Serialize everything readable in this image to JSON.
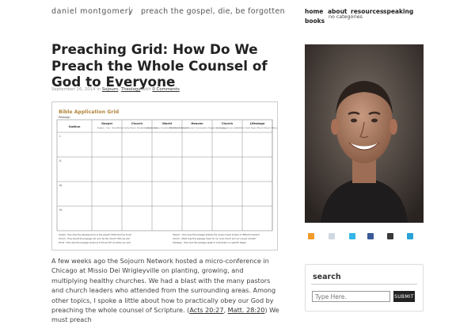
{
  "header": {
    "site_title": "daniel montgomery",
    "separator": "|",
    "tagline": "preach the gospel, die, be forgotten",
    "nav": [
      "home",
      "about",
      "resources",
      "speaking",
      "books"
    ],
    "sub_nav": "no categories"
  },
  "post": {
    "title": "Preaching Grid: How Do We Preach the Whole Counsel of God to Everyone",
    "date": "September 26, 2014 in",
    "category_1": "Sojourn",
    "category_sep": ",",
    "category_2": "Theology",
    "with": "with",
    "comments": "0 Comments",
    "body_1": "A few weeks ago the Sojourn Network hosted a micro-conference in Chicago at Missio Dei Wrigleyville on planting, growing, and multiplying healthy churches. We had a blast with the many pastors and church leaders who attended from the surrounding areas. Among other topics, I spoke a little about how to practically obey our God by preaching the whole counsel of Scripture. (",
    "ref_1": "Acts 20:27",
    "ref_sep": ", ",
    "ref_2": "Matt. 28:20",
    "body_2": ") We must preach"
  },
  "grid": {
    "title": "Bible Application Grid",
    "subtitle": "Passage:",
    "row_header": "Outline",
    "columns": [
      {
        "name": "Gospel",
        "desc": "Kingdom - Cross - Grace"
      },
      {
        "name": "Church",
        "desc": "Worship, Family, Mission, Discipleship, Membership"
      },
      {
        "name": "World",
        "desc": "Injustice, Idolatry, Secularism, Rebellion, Brokenness"
      },
      {
        "name": "Heaven",
        "desc": "New Creation, Cultural Renewal, Consummation, Kingdom, Justice, Joy"
      },
      {
        "name": "Church",
        "desc": "Our congregation as a whole"
      },
      {
        "name": "Lifestage",
        "desc": "Children, Youth, Singles, Married, Parents, Elderly"
      }
    ],
    "row_labels": [
      "I.",
      "II.",
      "III.",
      "IV."
    ],
    "footer_left": [
      "Gospel - How does the passage show us the gospel? What God has done?",
      "Church - How should the passage call us to be the church? Who we are?",
      "World - How does the passage reveal us to the world? As where you are?"
    ],
    "footer_right": [
      "Heaven - How does this passage address the unique hopes & fears of different hearers?",
      "Church - What does this passage mean for our local church and our unique context?",
      "Lifestage - How does this passage speak to individuals in a specific stage?"
    ]
  },
  "sidebar": {
    "photo_alt": "portrait",
    "social_icons": [
      "rss-icon",
      "email-icon",
      "twitter-icon",
      "facebook-icon",
      "google-plus-icon",
      "vimeo-icon"
    ],
    "search": {
      "title": "search",
      "placeholder": "Type Here.",
      "button": "SUBMIT"
    }
  }
}
